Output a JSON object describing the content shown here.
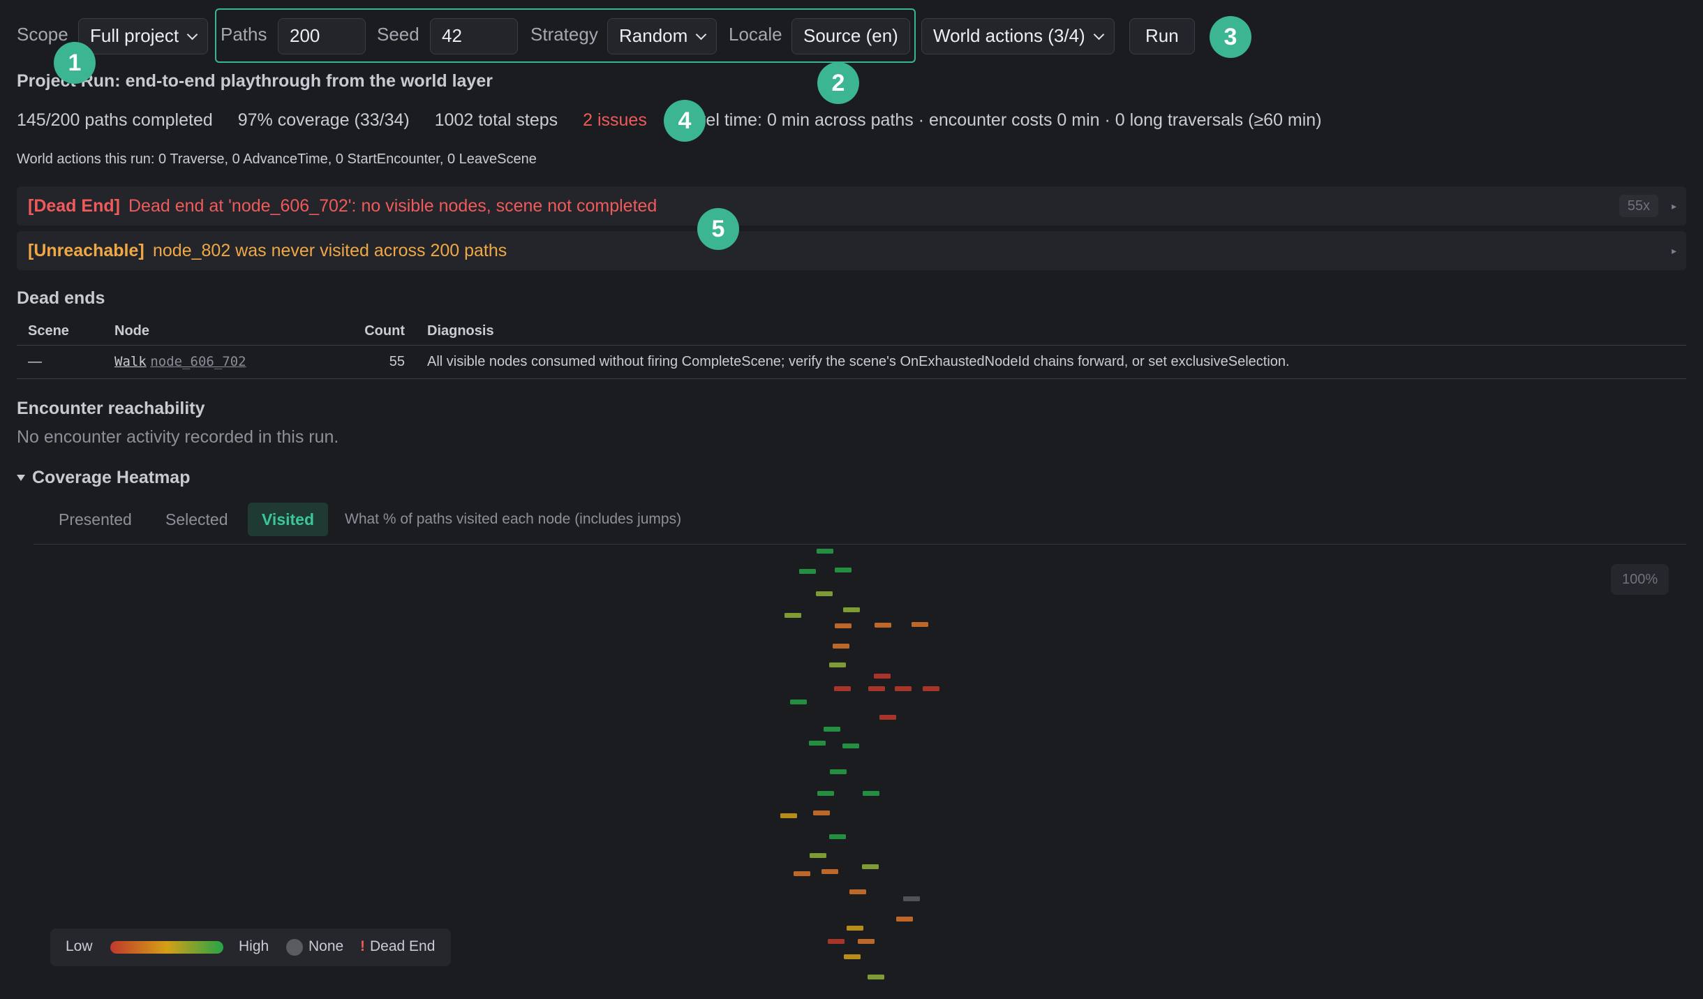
{
  "toolbar": {
    "scope_label": "Scope",
    "scope_value": "Full project",
    "paths_label": "Paths",
    "paths_value": "200",
    "seed_label": "Seed",
    "seed_value": "42",
    "strategy_label": "Strategy",
    "strategy_value": "Random",
    "locale_label": "Locale",
    "locale_value": "Source (en)",
    "world_actions_value": "World actions (3/4)",
    "run_label": "Run"
  },
  "markers": [
    "1",
    "2",
    "3",
    "4",
    "5"
  ],
  "summary": {
    "title": "Project Run: end-to-end playthrough from the world layer",
    "paths_completed": "145/200 paths completed",
    "coverage": "97% coverage (33/34)",
    "total_steps": "1002 total steps",
    "issues": "2 issues",
    "travel": "Travel time: 0 min across paths · encounter costs 0 min · 0 long traversals (≥60 min)",
    "world_actions": "World actions this run: 0 Traverse, 0 AdvanceTime, 0 StartEncounter, 0 LeaveScene"
  },
  "issues": [
    {
      "tag": "[Dead End]",
      "message": "Dead end at 'node_606_702': no visible nodes, scene not completed",
      "count": "55x"
    },
    {
      "tag": "[Unreachable]",
      "message": "node_802 was never visited across 200 paths"
    }
  ],
  "dead_ends": {
    "title": "Dead ends",
    "columns": [
      "Scene",
      "Node",
      "Count",
      "Diagnosis"
    ],
    "rows": [
      {
        "scene": "—",
        "node_type": "Walk",
        "node_id": "node_606_702",
        "count": "55",
        "diagnosis": "All visible nodes consumed without firing CompleteScene; verify the scene's OnExhaustedNodeId chains forward, or set exclusiveSelection."
      }
    ]
  },
  "encounters": {
    "title": "Encounter reachability",
    "empty": "No encounter activity recorded in this run."
  },
  "heatmap": {
    "title": "Coverage Heatmap",
    "tabs": [
      "Presented",
      "Selected",
      "Visited"
    ],
    "active_tab": "Visited",
    "hint": "What % of paths visited each node (includes jumps)",
    "zoom": "100%",
    "legend": {
      "low": "Low",
      "high": "High",
      "none": "None",
      "dead_end_mark": "!",
      "dead_end": "Dead End"
    },
    "colors": {
      "high": "#27a348",
      "mid": "#d4a017",
      "low": "#c0392b",
      "none": "#5a5c62"
    }
  }
}
